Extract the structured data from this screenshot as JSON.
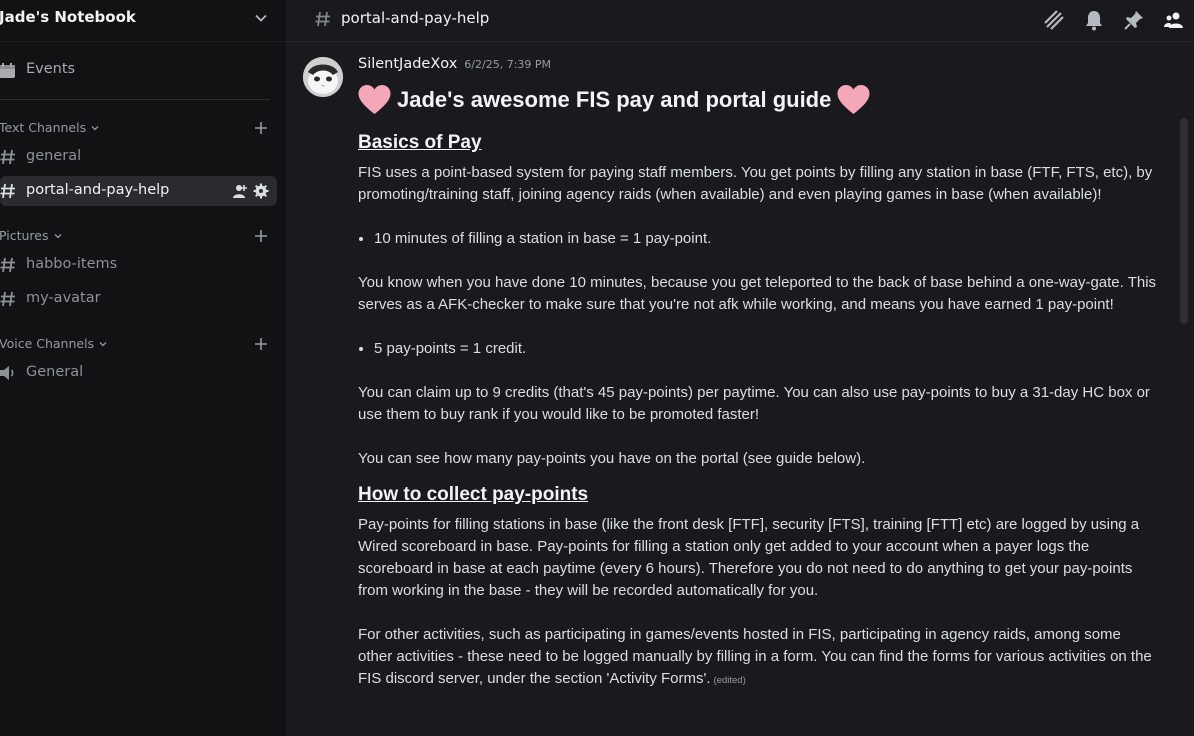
{
  "server": {
    "name": "Jade's Notebook"
  },
  "sidebar": {
    "events_label": "Events",
    "categories": [
      {
        "label": "Text Channels",
        "channels": [
          "general",
          "portal-and-pay-help"
        ]
      },
      {
        "label": "Pictures",
        "channels": [
          "habbo-items",
          "my-avatar"
        ]
      },
      {
        "label": "Voice Channels",
        "channels": [
          "General"
        ]
      }
    ],
    "active_channel": "portal-and-pay-help"
  },
  "topbar": {
    "channel_name": "portal-and-pay-help"
  },
  "message": {
    "author": "SilentJadeXox",
    "timestamp": "6/2/25, 7:39 PM",
    "title": "Jade's awesome FIS pay and portal guide",
    "section1_heading": "Basics of Pay",
    "p1": "FIS uses a point-based system for paying staff members. You get points by filling any station in base (FTF, FTS, etc), by promoting/training staff, joining agency raids (when available) and even playing games in base (when available)!",
    "bullet1": "10 minutes of filling a station in base = 1 pay-point.",
    "p2": "You know when you have done 10 minutes, because you get teleported to the back of base behind a one-way-gate. This serves as a AFK-checker to make sure that you're not afk while working, and means you have earned 1 pay-point!",
    "bullet2": "5 pay-points = 1 credit.",
    "p3": "You can claim up to 9 credits (that's 45 pay-points) per paytime. You can also use pay-points to buy a 31-day HC box or use them to buy rank if you would like to be promoted faster!",
    "p4": "You can see how many pay-points you have on the portal (see guide below).",
    "section2_heading": "How to collect pay-points",
    "p5": "Pay-points for filling stations in base (like the front desk [FTF], security [FTS], training [FTT] etc) are logged by using a Wired scoreboard in base. Pay-points for filling a station only get added to your account when a payer logs the scoreboard in base at each paytime (every 6 hours). Therefore you do not need to do anything to get your pay-points from working in the base - they will be recorded automatically for you.",
    "p6": "For other activities, such as participating in games/events hosted in FIS, participating in agency raids, among some other activities - these need to be logged manually by filling in a form. You can find the forms for various activities on the FIS discord server, under the section 'Activity Forms'.",
    "edited": "(edited)"
  },
  "colors": {
    "heart": "#f4a7b9",
    "active_channel_bg": "#2a2a2f",
    "background": "#1a1a1e"
  }
}
